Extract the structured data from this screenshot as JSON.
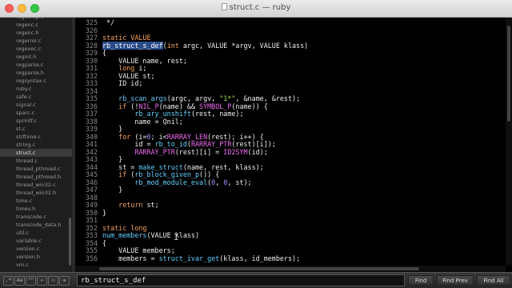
{
  "window": {
    "title": "struct.c — ruby"
  },
  "sidebar": {
    "files": [
      "regcomp.c",
      "regenc.c",
      "regenc.h",
      "regerror.c",
      "regexec.c",
      "regint.h",
      "regparse.c",
      "regparse.h",
      "regsyntax.c",
      "ruby.c",
      "safe.c",
      "signal.c",
      "sparc.c",
      "sprintf.c",
      "st.c",
      "strftime.c",
      "string.c",
      "struct.c",
      "thread.c",
      "thread_pthread.c",
      "thread_pthread.h",
      "thread_win32.c",
      "thread_win32.h",
      "time.c",
      "timev.h",
      "transcode.c",
      "transcode_data.h",
      "util.c",
      "variable.c",
      "version.c",
      "version.h",
      "vm.c"
    ],
    "active_file": "struct.c"
  },
  "editor": {
    "lines": [
      {
        "n": "325",
        "tokens": [
          {
            "t": " */"
          }
        ]
      },
      {
        "n": "326",
        "tokens": []
      },
      {
        "n": "327",
        "tokens": [
          {
            "t": "static VALUE",
            "c": "kw"
          }
        ]
      },
      {
        "n": "328",
        "tokens": [
          {
            "t": "rb_struct_s_def",
            "c": "cur"
          },
          {
            "t": "(",
            "c": ""
          },
          {
            "t": "int",
            "c": "kw"
          },
          {
            "t": " argc, VALUE *argv, VALUE klass)"
          }
        ]
      },
      {
        "n": "329",
        "tokens": [
          {
            "t": "{"
          }
        ]
      },
      {
        "n": "330",
        "tokens": [
          {
            "t": "    VALUE name, rest;"
          }
        ]
      },
      {
        "n": "331",
        "tokens": [
          {
            "t": "    "
          },
          {
            "t": "long",
            "c": "kw"
          },
          {
            "t": " i;"
          }
        ]
      },
      {
        "n": "332",
        "tokens": [
          {
            "t": "    VALUE st;"
          }
        ]
      },
      {
        "n": "333",
        "tokens": [
          {
            "t": "    ID id;"
          }
        ]
      },
      {
        "n": "334",
        "tokens": []
      },
      {
        "n": "335",
        "tokens": [
          {
            "t": "    "
          },
          {
            "t": "rb_scan_args",
            "c": "fn"
          },
          {
            "t": "(argc, argv, "
          },
          {
            "t": "\"1*\"",
            "c": "str"
          },
          {
            "t": ", &name, &rest);"
          }
        ]
      },
      {
        "n": "336",
        "tokens": [
          {
            "t": "    "
          },
          {
            "t": "if",
            "c": "kw"
          },
          {
            "t": " (!"
          },
          {
            "t": "NIL_P",
            "c": "mac"
          },
          {
            "t": "(name) && "
          },
          {
            "t": "SYMBOL_P",
            "c": "mac"
          },
          {
            "t": "(name)) {"
          }
        ]
      },
      {
        "n": "337",
        "tokens": [
          {
            "t": "        "
          },
          {
            "t": "rb_ary_unshift",
            "c": "fn"
          },
          {
            "t": "(rest, name);"
          }
        ]
      },
      {
        "n": "338",
        "tokens": [
          {
            "t": "        name = Qnil;"
          }
        ]
      },
      {
        "n": "339",
        "tokens": [
          {
            "t": "    }"
          }
        ]
      },
      {
        "n": "340",
        "tokens": [
          {
            "t": "    "
          },
          {
            "t": "for",
            "c": "kw"
          },
          {
            "t": " (i="
          },
          {
            "t": "0",
            "c": "num"
          },
          {
            "t": "; i<"
          },
          {
            "t": "RARRAY_LEN",
            "c": "mac"
          },
          {
            "t": "(rest); i++) {"
          }
        ]
      },
      {
        "n": "341",
        "tokens": [
          {
            "t": "        id = "
          },
          {
            "t": "rb_to_id",
            "c": "fn"
          },
          {
            "t": "("
          },
          {
            "t": "RARRAY_PTR",
            "c": "mac"
          },
          {
            "t": "(rest)[i]);"
          }
        ]
      },
      {
        "n": "342",
        "tokens": [
          {
            "t": "        "
          },
          {
            "t": "RARRAY_PTR",
            "c": "mac"
          },
          {
            "t": "(rest)[i] = "
          },
          {
            "t": "ID2SYM",
            "c": "mac"
          },
          {
            "t": "(id);"
          }
        ]
      },
      {
        "n": "343",
        "tokens": [
          {
            "t": "    }"
          }
        ]
      },
      {
        "n": "344",
        "tokens": [
          {
            "t": "    st = "
          },
          {
            "t": "make_struct",
            "c": "fn"
          },
          {
            "t": "(name, rest, klass);"
          }
        ]
      },
      {
        "n": "345",
        "tokens": [
          {
            "t": "    "
          },
          {
            "t": "if",
            "c": "kw"
          },
          {
            "t": " ("
          },
          {
            "t": "rb_block_given_p",
            "c": "fn"
          },
          {
            "t": "()) {"
          }
        ]
      },
      {
        "n": "346",
        "tokens": [
          {
            "t": "        "
          },
          {
            "t": "rb_mod_module_eval",
            "c": "fn"
          },
          {
            "t": "("
          },
          {
            "t": "0",
            "c": "num"
          },
          {
            "t": ", "
          },
          {
            "t": "0",
            "c": "num"
          },
          {
            "t": ", st);"
          }
        ]
      },
      {
        "n": "347",
        "tokens": [
          {
            "t": "    }"
          }
        ]
      },
      {
        "n": "348",
        "tokens": []
      },
      {
        "n": "349",
        "tokens": [
          {
            "t": "    "
          },
          {
            "t": "return",
            "c": "kw"
          },
          {
            "t": " st;"
          }
        ]
      },
      {
        "n": "350",
        "tokens": [
          {
            "t": "}"
          }
        ]
      },
      {
        "n": "351",
        "tokens": []
      },
      {
        "n": "352",
        "tokens": [
          {
            "t": "static long",
            "c": "kw"
          }
        ]
      },
      {
        "n": "353",
        "tokens": [
          {
            "t": "num_members",
            "c": "fn"
          },
          {
            "t": "(VALUE klass)"
          }
        ]
      },
      {
        "n": "354",
        "tokens": [
          {
            "t": "{"
          }
        ]
      },
      {
        "n": "355",
        "tokens": [
          {
            "t": "    VALUE members;"
          }
        ]
      },
      {
        "n": "356",
        "tokens": [
          {
            "t": "    members = "
          },
          {
            "t": "struct_ivar_get",
            "c": "fn"
          },
          {
            "t": "(klass, id_members);"
          }
        ]
      }
    ]
  },
  "findbar": {
    "option_icons": [
      "regex-icon",
      "case-icon",
      "word-icon",
      "wrap-icon",
      "selection-icon",
      "highlight-icon"
    ],
    "query": "rb_struct_s_def",
    "find_label": "Find",
    "find_prev_label": "Find Prev",
    "find_all_label": "Find All"
  },
  "colors": {
    "keyword": "#f7a35c",
    "function": "#62d0ff",
    "macro": "#f26bf2",
    "string": "#a6e22e",
    "number": "#b08cff",
    "background": "#000000"
  }
}
